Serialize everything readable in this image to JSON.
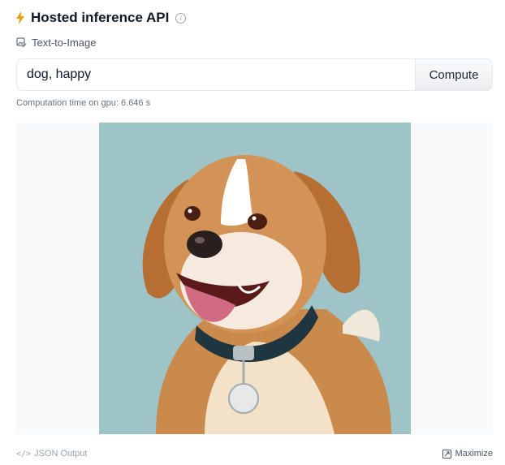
{
  "header": {
    "title": "Hosted inference API",
    "icon": "lightning-icon",
    "info_icon": "info-icon"
  },
  "task": {
    "label": "Text-to-Image",
    "icon": "text-to-image-icon"
  },
  "prompt": {
    "value": "dog, happy"
  },
  "compute_button": {
    "label": "Compute"
  },
  "computation_time": "Computation time on gpu: 6.646 s",
  "image": {
    "subject": "smiling brown and white dog with collar"
  },
  "footer": {
    "json_output": "JSON Output",
    "maximize": "Maximize"
  },
  "colors": {
    "lightning": "#f59e0b",
    "image_background": "#9ec4c8",
    "dog_coat": "#c98a4b"
  }
}
